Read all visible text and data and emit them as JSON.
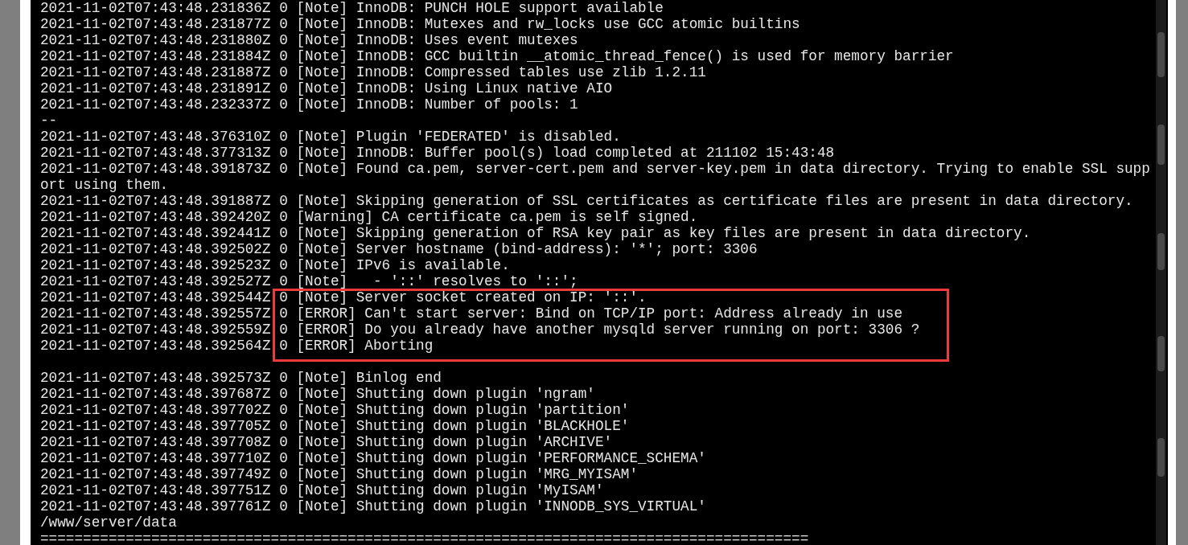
{
  "terminal": {
    "lines": [
      {
        "kind": "text",
        "text": "2021-11-02T07:43:48.231836Z 0 [Note] InnoDB: PUNCH HOLE support available",
        "highlighted": false
      },
      {
        "kind": "text",
        "text": "2021-11-02T07:43:48.231877Z 0 [Note] InnoDB: Mutexes and rw_locks use GCC atomic builtins",
        "highlighted": false
      },
      {
        "kind": "text",
        "text": "2021-11-02T07:43:48.231880Z 0 [Note] InnoDB: Uses event mutexes",
        "highlighted": false
      },
      {
        "kind": "text",
        "text": "2021-11-02T07:43:48.231884Z 0 [Note] InnoDB: GCC builtin __atomic_thread_fence() is used for memory barrier",
        "highlighted": false
      },
      {
        "kind": "text",
        "text": "2021-11-02T07:43:48.231887Z 0 [Note] InnoDB: Compressed tables use zlib 1.2.11",
        "highlighted": false
      },
      {
        "kind": "text",
        "text": "2021-11-02T07:43:48.231891Z 0 [Note] InnoDB: Using Linux native AIO",
        "highlighted": false
      },
      {
        "kind": "text",
        "text": "2021-11-02T07:43:48.232337Z 0 [Note] InnoDB: Number of pools: 1",
        "highlighted": false
      },
      {
        "kind": "text",
        "text": "--",
        "highlighted": false
      },
      {
        "kind": "text",
        "text": "2021-11-02T07:43:48.376310Z 0 [Note] Plugin 'FEDERATED' is disabled.",
        "highlighted": false
      },
      {
        "kind": "text",
        "text": "2021-11-02T07:43:48.377313Z 0 [Note] InnoDB: Buffer pool(s) load completed at 211102 15:43:48",
        "highlighted": false
      },
      {
        "kind": "text",
        "text": "2021-11-02T07:43:48.391873Z 0 [Note] Found ca.pem, server-cert.pem and server-key.pem in data directory. Trying to enable SSL support using them.",
        "highlighted": false
      },
      {
        "kind": "text",
        "text": "2021-11-02T07:43:48.391887Z 0 [Note] Skipping generation of SSL certificates as certificate files are present in data directory.",
        "highlighted": false
      },
      {
        "kind": "text",
        "text": "2021-11-02T07:43:48.392420Z 0 [Warning] CA certificate ca.pem is self signed.",
        "highlighted": false
      },
      {
        "kind": "text",
        "text": "2021-11-02T07:43:48.392441Z 0 [Note] Skipping generation of RSA key pair as key files are present in data directory.",
        "highlighted": false
      },
      {
        "kind": "text",
        "text": "2021-11-02T07:43:48.392502Z 0 [Note] Server hostname (bind-address): '*'; port: 3306",
        "highlighted": false
      },
      {
        "kind": "text",
        "text": "2021-11-02T07:43:48.392523Z 0 [Note] IPv6 is available.",
        "highlighted": false
      },
      {
        "kind": "text",
        "text": "2021-11-02T07:43:48.392527Z 0 [Note]   - '::' resolves to '::';",
        "highlighted": false
      },
      {
        "kind": "text",
        "text": "2021-11-02T07:43:48.392544Z 0 [Note] Server socket created on IP: '::'.",
        "highlighted": true
      },
      {
        "kind": "text",
        "text": "2021-11-02T07:43:48.392557Z 0 [ERROR] Can't start server: Bind on TCP/IP port: Address already in use",
        "highlighted": true
      },
      {
        "kind": "text",
        "text": "2021-11-02T07:43:48.392559Z 0 [ERROR] Do you already have another mysqld server running on port: 3306 ?",
        "highlighted": true
      },
      {
        "kind": "text",
        "text": "2021-11-02T07:43:48.392564Z 0 [ERROR] Aborting",
        "highlighted": true
      },
      {
        "kind": "blank",
        "highlighted": false
      },
      {
        "kind": "text",
        "text": "2021-11-02T07:43:48.392573Z 0 [Note] Binlog end",
        "highlighted": false
      },
      {
        "kind": "text",
        "text": "2021-11-02T07:43:48.397687Z 0 [Note] Shutting down plugin 'ngram'",
        "highlighted": false
      },
      {
        "kind": "text",
        "text": "2021-11-02T07:43:48.397702Z 0 [Note] Shutting down plugin 'partition'",
        "highlighted": false
      },
      {
        "kind": "text",
        "text": "2021-11-02T07:43:48.397705Z 0 [Note] Shutting down plugin 'BLACKHOLE'",
        "highlighted": false
      },
      {
        "kind": "text",
        "text": "2021-11-02T07:43:48.397708Z 0 [Note] Shutting down plugin 'ARCHIVE'",
        "highlighted": false
      },
      {
        "kind": "text",
        "text": "2021-11-02T07:43:48.397710Z 0 [Note] Shutting down plugin 'PERFORMANCE_SCHEMA'",
        "highlighted": false
      },
      {
        "kind": "text",
        "text": "2021-11-02T07:43:48.397749Z 0 [Note] Shutting down plugin 'MRG_MYISAM'",
        "highlighted": false
      },
      {
        "kind": "text",
        "text": "2021-11-02T07:43:48.397751Z 0 [Note] Shutting down plugin 'MyISAM'",
        "highlighted": false
      },
      {
        "kind": "text",
        "text": "2021-11-02T07:43:48.397761Z 0 [Note] Shutting down plugin 'INNODB_SYS_VIRTUAL'",
        "highlighted": false
      },
      {
        "kind": "text",
        "text": "/www/server/data",
        "highlighted": false
      },
      {
        "kind": "text",
        "text": "==========================================================================================",
        "highlighted": false
      }
    ]
  }
}
